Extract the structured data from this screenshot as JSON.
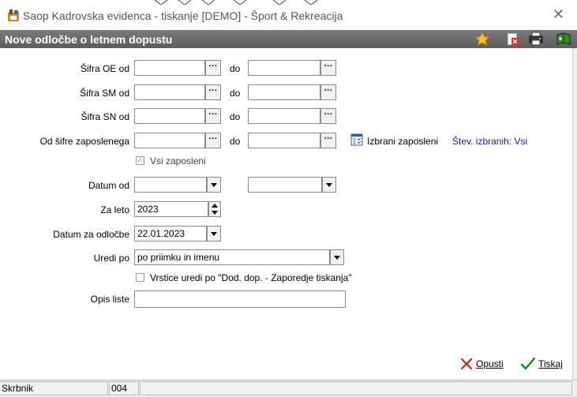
{
  "window": {
    "title": "Saop Kadrovska evidenca  - tiskanje [DEMO] - Šport & Rekreacija",
    "close": "✕"
  },
  "header": {
    "title": "Nove odločbe o letnem dopustu",
    "icons": [
      "star-icon",
      "delete-report-icon",
      "printer-icon",
      "book-icon"
    ]
  },
  "form": {
    "oe": {
      "label": "Šifra OE od",
      "from": "",
      "to": "",
      "sep": "do",
      "dots": "···"
    },
    "sm": {
      "label": "Šifra SM od",
      "from": "",
      "to": "",
      "sep": "do",
      "dots": "···"
    },
    "sn": {
      "label": "Šifra SN od",
      "from": "",
      "to": "",
      "sep": "do",
      "dots": "···"
    },
    "zap": {
      "label": "Od šifre zaposlenega",
      "from": "",
      "to": "",
      "sep": "do",
      "dots": "···",
      "selected_label": "Izbrani zaposleni",
      "count_label": "Štev. izbranih: Vsi"
    },
    "vsi": {
      "label": "Vsi zaposleni",
      "checked": true
    },
    "datum_od": {
      "label": "Datum od",
      "from": "",
      "to": ""
    },
    "za_leto": {
      "label": "Za leto",
      "value": "2023"
    },
    "datum_odl": {
      "label": "Datum za odločbe",
      "value": "22.01.2023"
    },
    "uredi": {
      "label": "Uredi po",
      "value": "po priimku in imenu"
    },
    "vrstice": {
      "label": "Vrstice uredi po \"Dod. dop. - Zaporedje tiskanja\"",
      "checked": false
    },
    "opis": {
      "label": "Opis liste",
      "value": ""
    }
  },
  "footer": {
    "cancel": "Opusti",
    "print": "Tiskaj"
  },
  "status": {
    "user": "Skrbnik",
    "code": "004"
  },
  "colors": {
    "header_bg": "#6b6b6b",
    "link": "#1a1aa6",
    "cancel_x": "#d11a1a",
    "print_check": "#1b8a1b"
  }
}
